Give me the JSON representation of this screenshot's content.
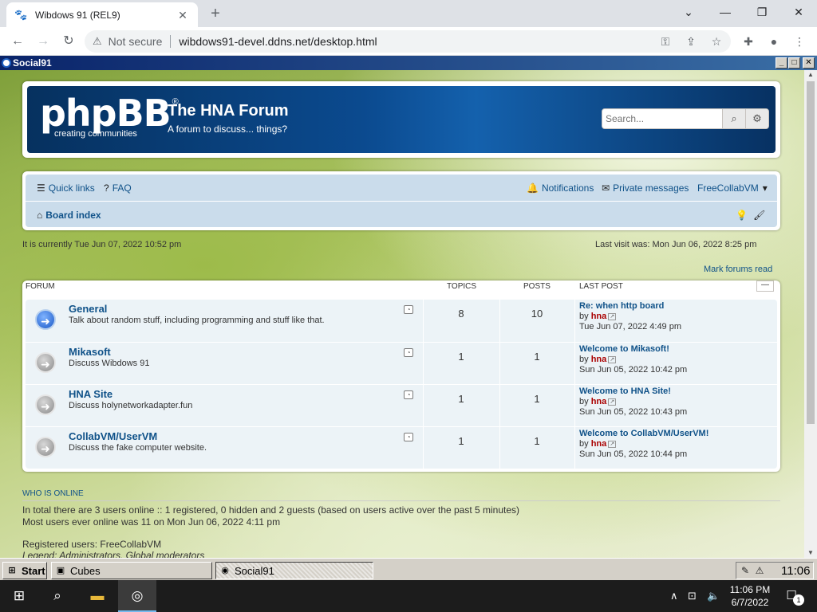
{
  "browser": {
    "tab_title": "Wibdows 91 (REL9)",
    "security_label": "Not secure",
    "url": "wibdows91-devel.ddns.net/desktop.html"
  },
  "window": {
    "title": "Social91"
  },
  "forum": {
    "logo_text": "phpBB",
    "logo_sub": "creating communities",
    "site_title": "The HNA Forum",
    "site_desc": "A forum to discuss... things?",
    "search_placeholder": "Search...",
    "nav": {
      "quick_links": "Quick links",
      "faq": "FAQ",
      "notifications": "Notifications",
      "private_messages": "Private messages",
      "user": "FreeCollabVM",
      "board_index": "Board index"
    },
    "current_time": "It is currently Tue Jun 07, 2022 10:52 pm",
    "last_visit": "Last visit was: Mon Jun 06, 2022 8:25 pm",
    "mark_read": "Mark forums read",
    "columns": {
      "forum": "FORUM",
      "topics": "TOPICS",
      "posts": "POSTS",
      "last_post": "LAST POST"
    },
    "forums": [
      {
        "name": "General",
        "desc": "Talk about random stuff, including programming and stuff like that.",
        "topics": "8",
        "posts": "10",
        "last_title": "Re: when http board",
        "last_by": "by",
        "last_author": "hna",
        "last_time": "Tue Jun 07, 2022 4:49 pm",
        "unread": true
      },
      {
        "name": "Mikasoft",
        "desc": "Discuss Wibdows 91",
        "topics": "1",
        "posts": "1",
        "last_title": "Welcome to Mikasoft!",
        "last_by": "by",
        "last_author": "hna",
        "last_time": "Sun Jun 05, 2022 10:42 pm",
        "unread": false
      },
      {
        "name": "HNA Site",
        "desc": "Discuss holynetworkadapter.fun",
        "topics": "1",
        "posts": "1",
        "last_title": "Welcome to HNA Site!",
        "last_by": "by",
        "last_author": "hna",
        "last_time": "Sun Jun 05, 2022 10:43 pm",
        "unread": false
      },
      {
        "name": "CollabVM/UserVM",
        "desc": "Discuss the fake computer website.",
        "topics": "1",
        "posts": "1",
        "last_title": "Welcome to CollabVM/UserVM!",
        "last_by": "by",
        "last_author": "hna",
        "last_time": "Sun Jun 05, 2022 10:44 pm",
        "unread": false
      }
    ],
    "who_is_online": "WHO IS ONLINE",
    "online_line1": "In total there are 3 users online :: 1 registered, 0 hidden and 2 guests (based on users active over the past 5 minutes)",
    "online_line2": "Most users ever online was 11 on Mon Jun 06, 2022 4:11 pm",
    "online_line3": "Registered users: FreeCollabVM",
    "online_line4": "Legend: Administrators, Global moderators"
  },
  "w91_taskbar": {
    "start": "Start",
    "items": [
      "Cubes",
      "Social91"
    ],
    "clock": "11:06"
  },
  "win10_taskbar": {
    "time": "11:06 PM",
    "date": "6/7/2022",
    "notif_count": "1"
  },
  "colors": {
    "link": "#105289",
    "author": "#aa0000",
    "header_blue": "#0b4a8f"
  }
}
